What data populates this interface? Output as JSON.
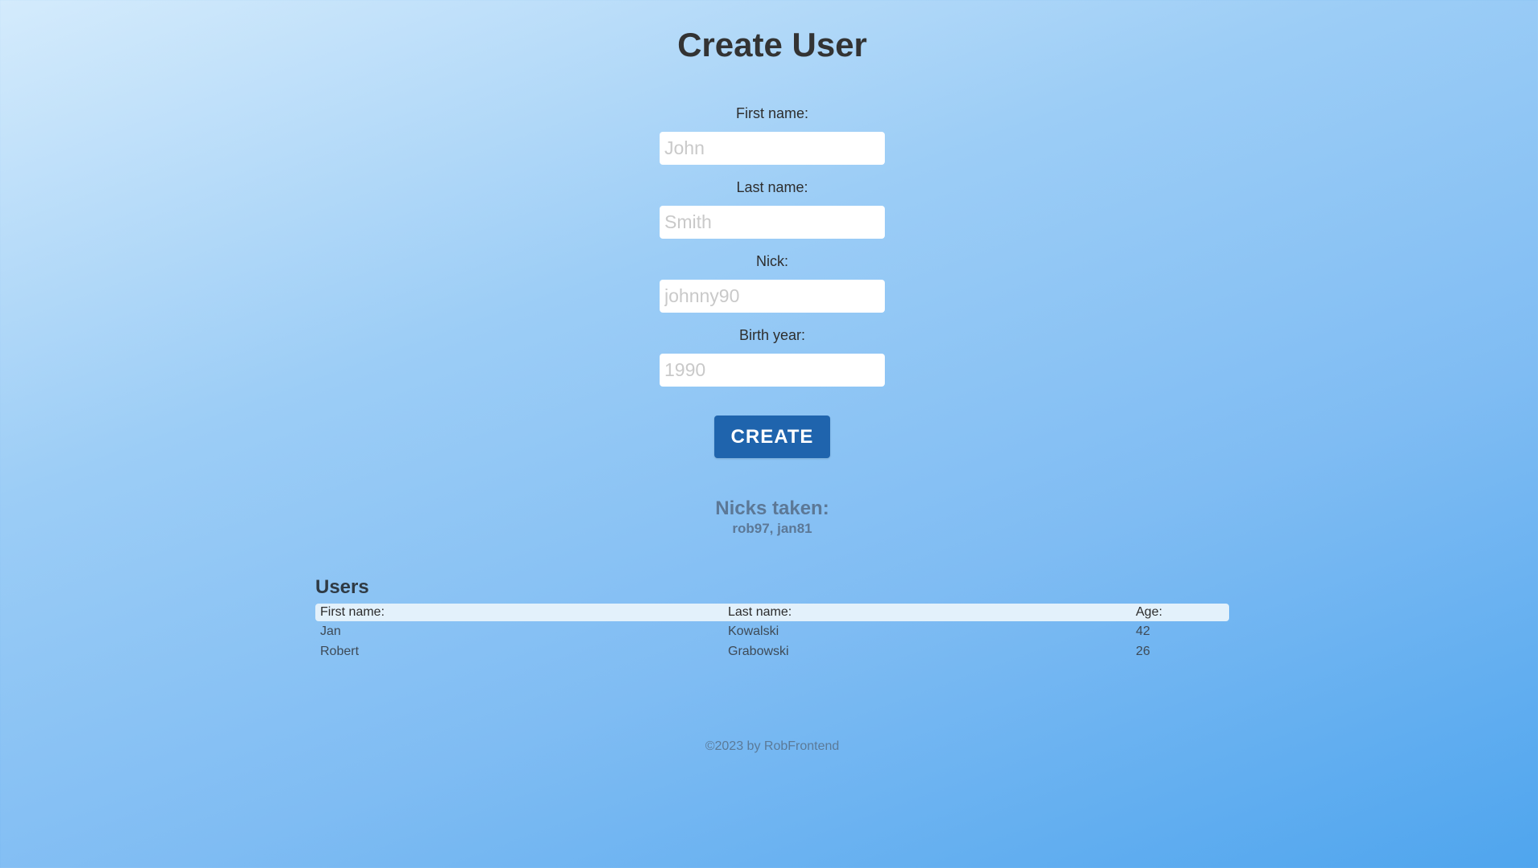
{
  "page": {
    "title": "Create User"
  },
  "form": {
    "fields": [
      {
        "label": "First name:",
        "value": "",
        "placeholder": "John"
      },
      {
        "label": "Last name:",
        "value": "",
        "placeholder": "Smith"
      },
      {
        "label": "Nick:",
        "value": "",
        "placeholder": "johnny90"
      },
      {
        "label": "Birth year:",
        "value": "",
        "placeholder": "1990"
      }
    ],
    "submit_label": "CREATE"
  },
  "nicks": {
    "title": "Nicks taken:",
    "list": "rob97, jan81"
  },
  "users": {
    "title": "Users",
    "columns": [
      "First name:",
      "Last name:",
      "Age:"
    ],
    "rows": [
      [
        "Jan",
        "Kowalski",
        "42"
      ],
      [
        "Robert",
        "Grabowski",
        "26"
      ]
    ]
  },
  "footer": {
    "text": "©2023 by RobFrontend"
  },
  "colors": {
    "accent_button": "#1f64ad",
    "background_top": "#d4ebfc",
    "background_bottom": "#4fa5ee"
  }
}
